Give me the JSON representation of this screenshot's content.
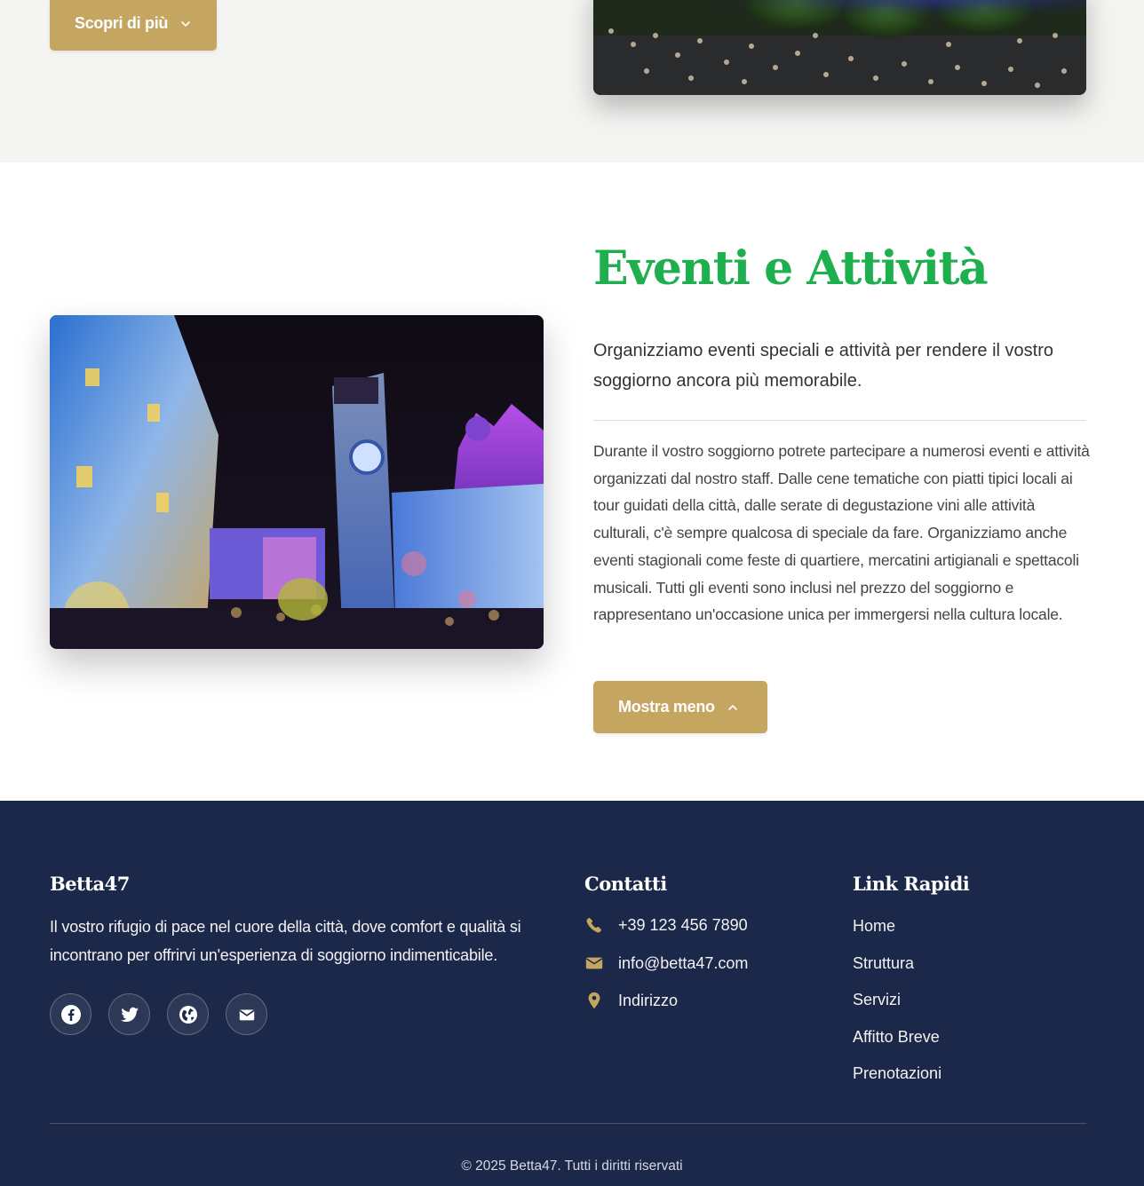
{
  "top": {
    "cta_label": "Scopri di più"
  },
  "events": {
    "title": "Eventi e Attività",
    "lead": "Organizziamo eventi speciali e attività per rendere il vostro soggiorno ancora più memorabile.",
    "body": "Durante il vostro soggiorno potrete partecipare a numerosi eventi e attività organizzati dal nostro staff. Dalle cene tematiche con piatti tipici locali ai tour guidati della città, dalle serate di degustazione vini alle attività culturali, c'è sempre qualcosa di speciale da fare. Organizziamo anche eventi stagionali come feste di quartiere, mercatini artigianali e spettacoli musicali. Tutti gli eventi sono inclusi nel prezzo del soggiorno e rappresentano un'occasione unica per immergersi nella cultura locale.",
    "toggle_label": "Mostra meno"
  },
  "footer": {
    "brand": "Betta47",
    "description": "Il vostro rifugio di pace nel cuore della città, dove comfort e qualità si incontrano per offrirvi un'esperienza di soggiorno indimenticabile.",
    "social": [
      {
        "icon": "facebook-icon"
      },
      {
        "icon": "twitter-icon"
      },
      {
        "icon": "globe-icon"
      },
      {
        "icon": "mail-icon"
      }
    ],
    "contacts_heading": "Contatti",
    "contacts": [
      {
        "icon": "phone-icon",
        "text": "+39 123 456 7890"
      },
      {
        "icon": "envelope-icon",
        "text": "info@betta47.com"
      },
      {
        "icon": "location-pin-icon",
        "text": "Indirizzo"
      }
    ],
    "links_heading": "Link Rapidi",
    "links": [
      "Home",
      "Struttura",
      "Servizi",
      "Affitto Breve",
      "Prenotazioni"
    ],
    "copyright": "© 2025 Betta47. Tutti i diritti riservati"
  },
  "colors": {
    "accent_gold": "#c4a661",
    "title_green": "#1eb04f",
    "footer_navy": "#1c2849",
    "top_bg": "#f4f4f2"
  }
}
